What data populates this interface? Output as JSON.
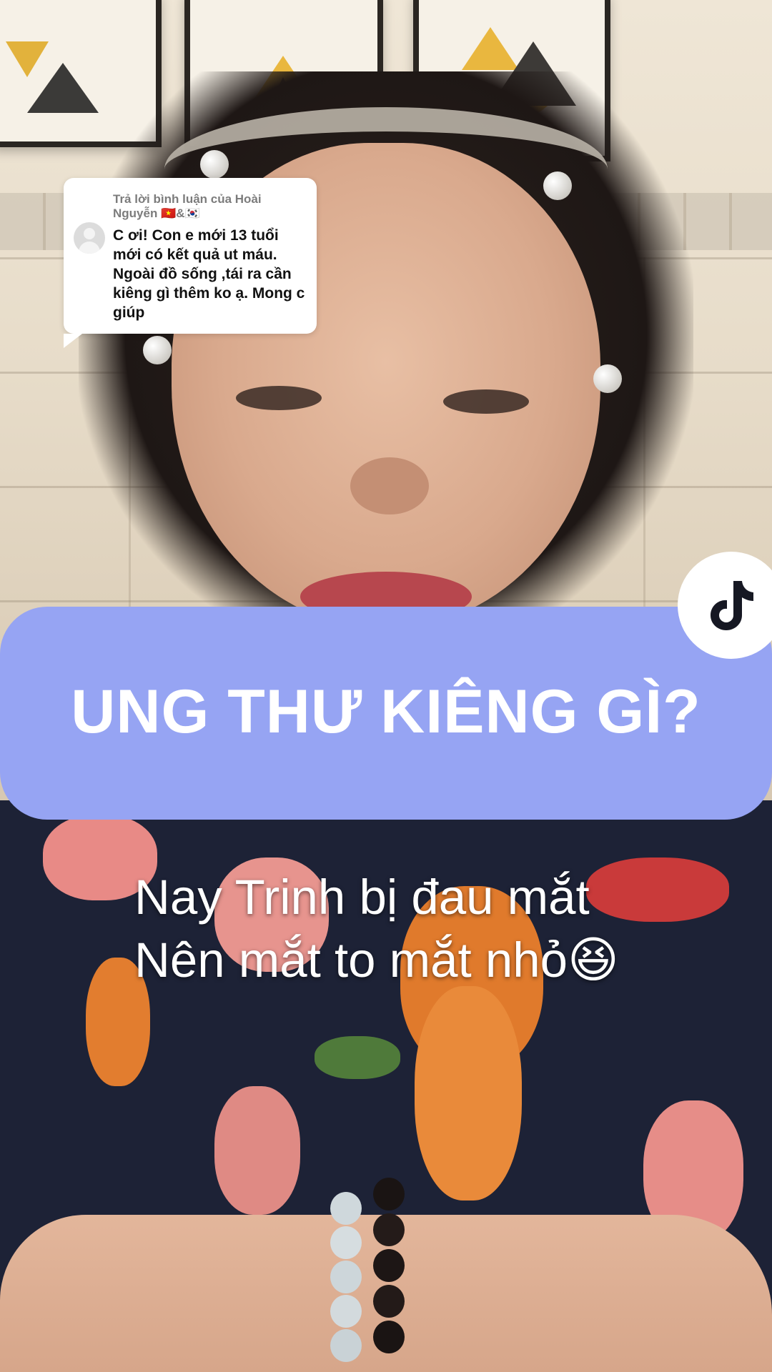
{
  "comment_reply": {
    "header": "Trả lời bình luận của Hoài Nguyễn 🇻🇳&🇰🇷",
    "text": "C ơi! Con e mới 13 tuổi mới có kết quả ut máu. Ngoài đồ sống ,tái ra cần kiêng gì thêm ko ạ. Mong c giúp"
  },
  "title_banner": {
    "text": "UNG THƯ KIÊNG GÌ?",
    "color": "#96a4f3"
  },
  "caption": {
    "line1": "Nay Trinh bị đau mắt",
    "line2": "Nên mắt to mắt nhỏ😆"
  },
  "badge": {
    "icon": "tiktok-logo-icon"
  }
}
